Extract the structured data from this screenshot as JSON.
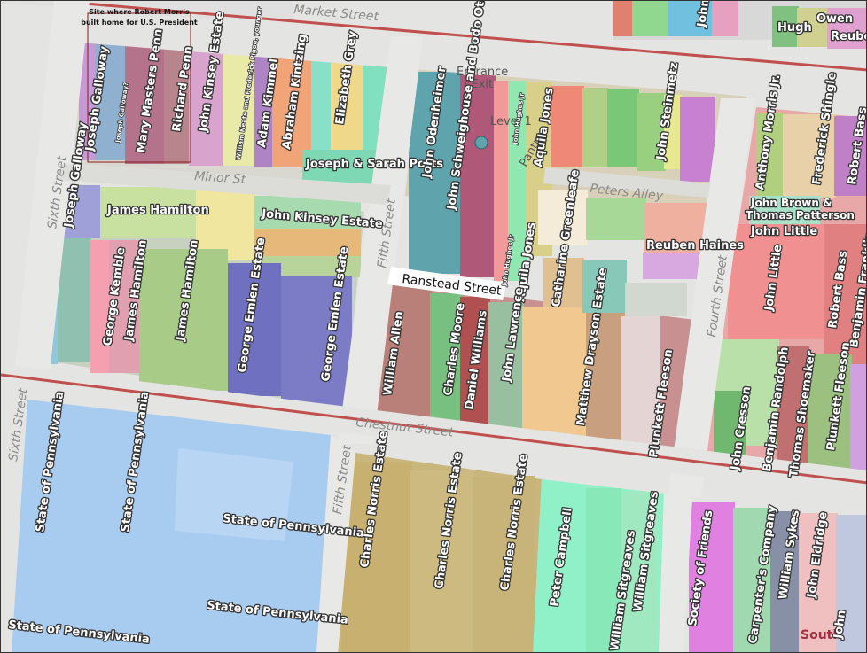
{
  "colors": {
    "road": "#e4e4e2",
    "railway_red": "#c0504d",
    "highlight_box": "#8b1a1a",
    "text_halo": "#333333"
  },
  "annotation": {
    "note_line1": "Site where Robert Morris",
    "note_line2": "built home for U.S. President"
  },
  "streets": {
    "market": "Market Street",
    "sixth_a": "Sixth Street",
    "sixth_b": "Sixth Street",
    "fifth_a": "Fifth Street",
    "fifth_b": "Fifth Street",
    "fourth": "Fourth Street",
    "minor": "Minor St",
    "peters": "Peters Alley",
    "ranstead": "Ranstead Street",
    "chestnut": "Chestnut Street"
  },
  "poi": {
    "entrance": "Entrance",
    "exit": "/ Exit",
    "level": "Level 1",
    "pantry": "Pantry"
  },
  "parcels": {
    "joseph_galloway": "Joseph Galloway",
    "joseph_galloway_q": "Joseph Galloway?",
    "mary_masters_penn": "Mary Masters Penn",
    "richard_penn": "Richard Penn",
    "john_kinsey_estate_a": "John Kinsey Estate",
    "william_neate": "William Neate and Frederick Pigou, younger",
    "adam_kimmel": "Adam Kimmel",
    "abraham_kintzing": "Abraham Kintzing",
    "elizabeth_grey": "Elizabeth Grey",
    "joseph_sarah_potts": "Joseph & Sarah Potts",
    "joseph_galloway_b": "Joseph Galloway",
    "james_hamilton_a": "James Hamilton",
    "john_kinsey_estate_b": "John Kinsey Estate",
    "george_kemble": "George Kemble",
    "james_hamilton_b": "James Hamilton",
    "james_hamilton_c": "James Hamilton",
    "george_emlen_a": "George Emlen Estate",
    "george_emlen_b": "George Emlen Estate",
    "john_odenheimer": "John Odenheimer",
    "john_schweighouse": "John Schweighouse and Bodo Otto",
    "john_hughes_jr_a": "John Hughes Jr",
    "aquila_jones_a": "Aquila Jones",
    "john_steinmetz": "John Steinmetz",
    "hugh": "Hugh",
    "owen": "Owen",
    "reuben": "Reuben",
    "john_a": "John",
    "anthony_morris": "Anthony Morris Jr.",
    "frederick_shingle": "Frederick Shingle",
    "robert_bass_a": "Robert Bass",
    "john_brown": "John Brown &",
    "thomas_patterson": "Thomas Patterson",
    "john_little_a": "John Little",
    "john_little_b": "John Little",
    "john_hughes_jr_b": "John Hughes Jr",
    "aquila_jones_b": "Aquila Jones",
    "catharine_greenleafe": "Catharine Greenleafe",
    "reuben_haines": "Reuben Haines",
    "robert_bass_b": "Robert Bass",
    "benjamin_franklin": "Benjamin Franklin",
    "william_allen": "William Allen",
    "charles_moore": "Charles Moore",
    "daniel_williams": "Daniel Williams",
    "john_lawrence": "John Lawrence",
    "matthew_drayson": "Matthew Drayson Estate",
    "plunkett_fleeson_a": "Plunkett Fleeson",
    "john_cresson": "John Cresson",
    "benjamin_randolph": "Benjamin Randolph",
    "thomas_shoemaker": "Thomas Shoemaker",
    "plunkett_fleeson_b": "Plunkett Fleeson",
    "state_pa_a": "State of Pennsylvania",
    "state_pa_b": "State of Pennsylvania",
    "state_pa_c": "State of Pennsylvania",
    "state_pa_d": "State of Pennsylvania",
    "state_pa_e": "State of Pennsylvania",
    "charles_norris_a": "Charles Norris Estate",
    "charles_norris_b": "Charles Norris Estate",
    "charles_norris_c": "Charles Norris Estate",
    "peter_campbell": "Peter Campbell",
    "william_sitgreaves_a": "William Sitgreaves",
    "william_sitgreaves_b": "William Sitgreaves",
    "society_friends": "Society of Friends",
    "carpenters_company": "Carpenter's Company",
    "william_sykes": "William Sykes",
    "john_eldridge": "John Eldridge",
    "john_b": "John",
    "south": "South"
  }
}
